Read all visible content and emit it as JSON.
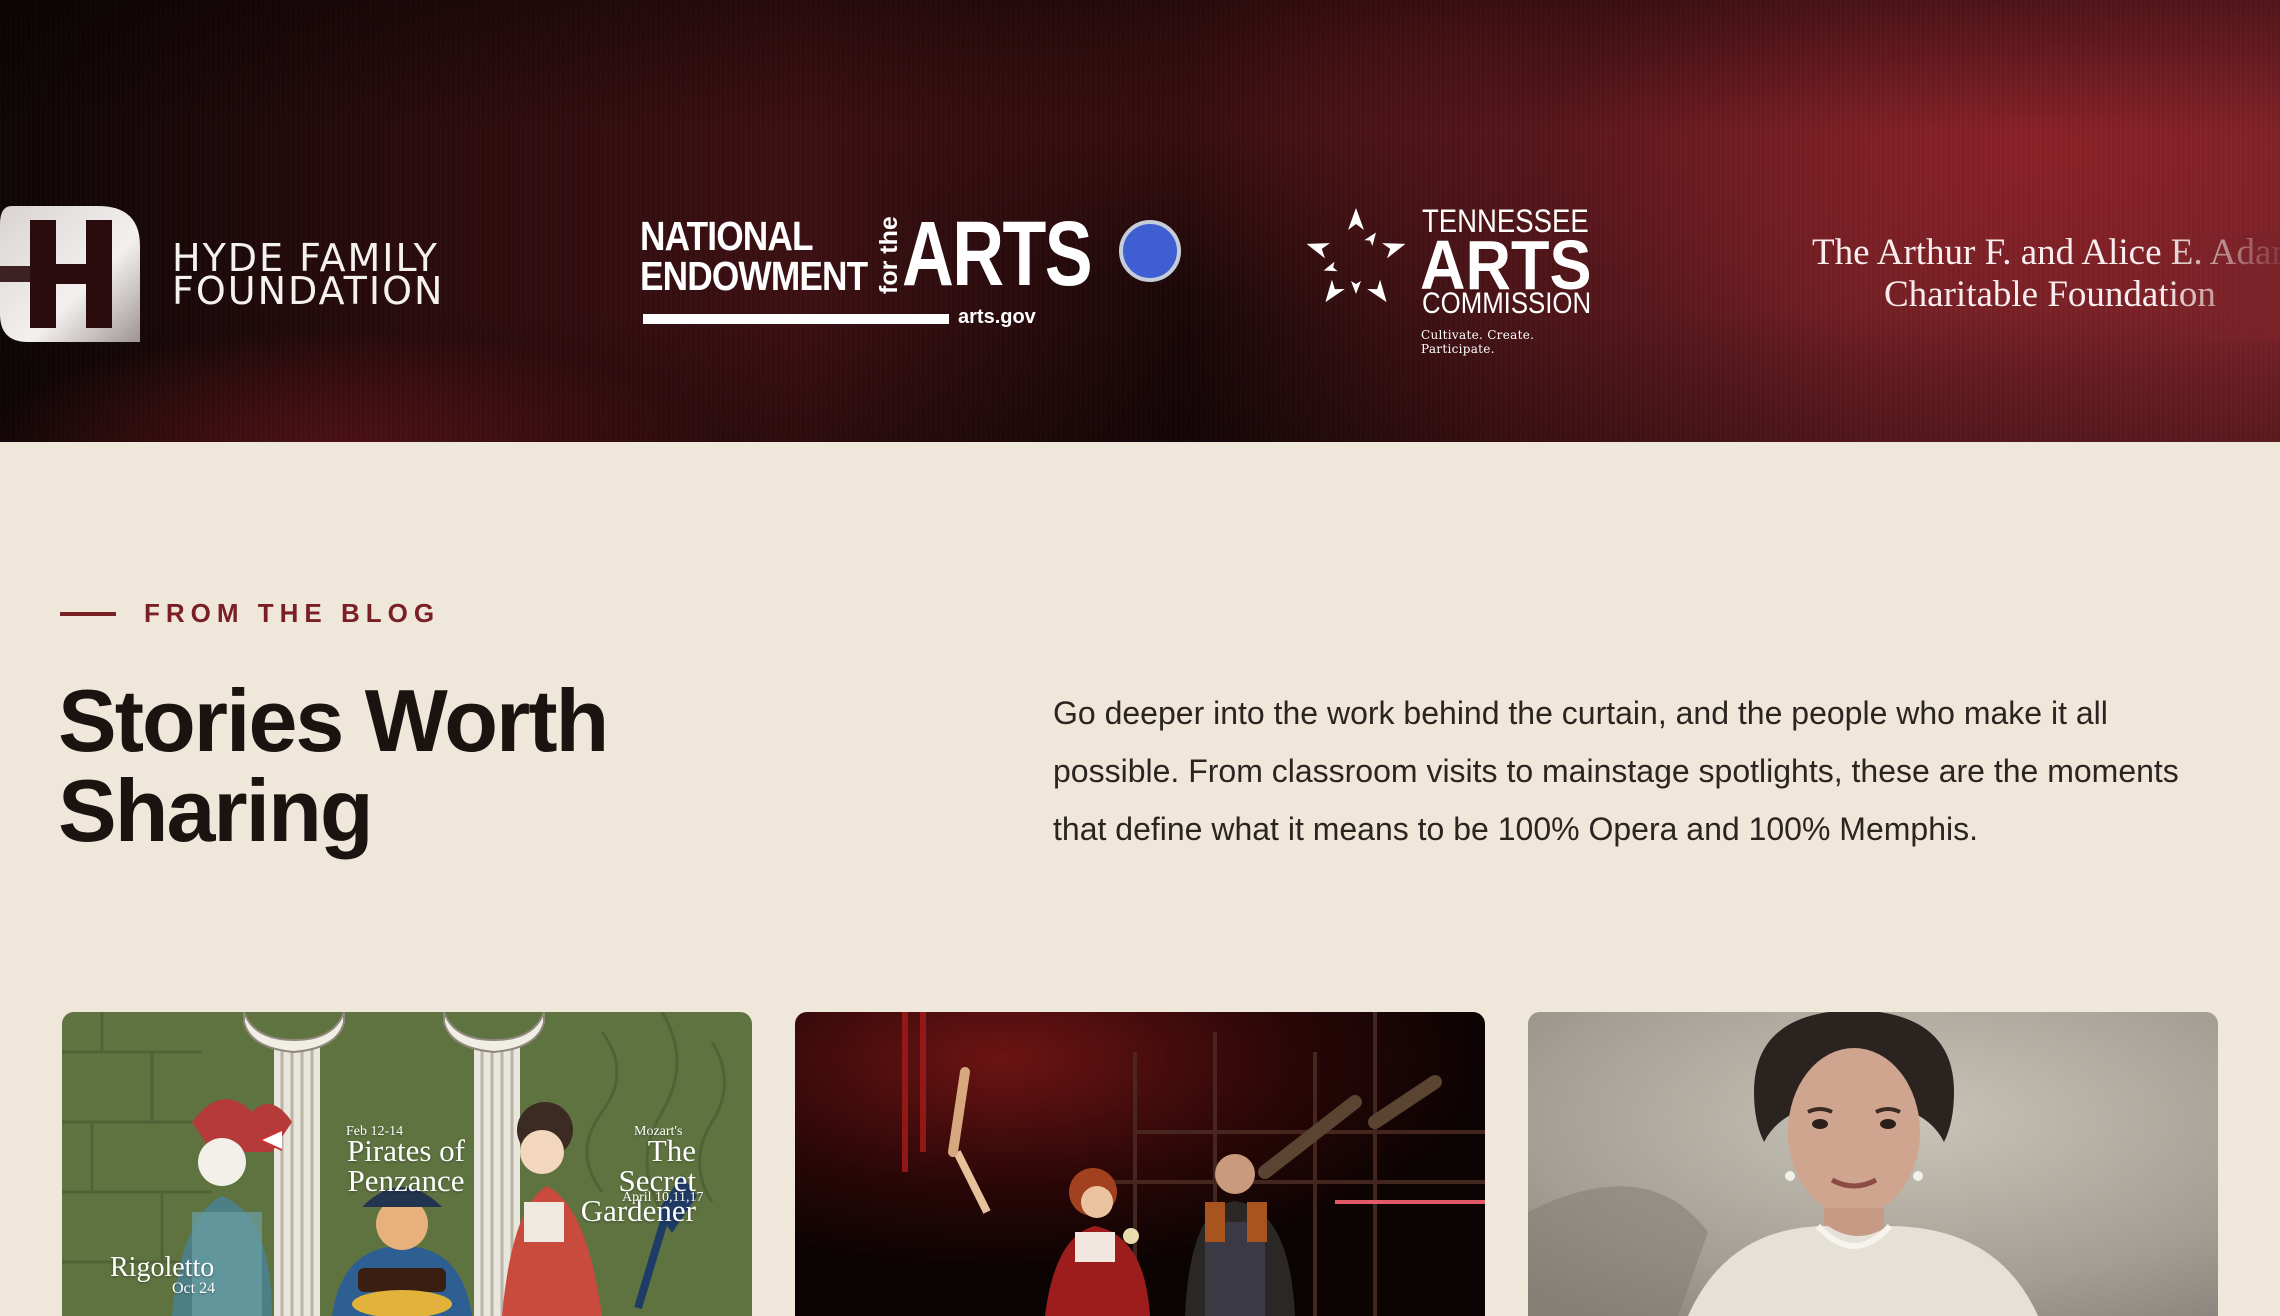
{
  "sponsors": {
    "hyde": {
      "name": "HYDE FAMILY\nFOUNDATION",
      "icon": "hyde-h-logo-icon"
    },
    "nea": {
      "left": "NATIONAL\nENDOWMENT",
      "for_the": "for the",
      "arts": "ARTS",
      "url": "arts.gov"
    },
    "tac": {
      "line1": "TENNESSEE",
      "line2": "ARTS",
      "line3": "COMMISSION",
      "tagline": "Cultivate. Create. Participate.",
      "icon": "tac-starburst-icon"
    },
    "adams": {
      "line1": "The Arthur F. and Alice E. Adams",
      "line2": "Charitable Foundation"
    }
  },
  "blog": {
    "eyebrow": "FROM THE BLOG",
    "heading": "Stories Worth Sharing",
    "intro": "Go deeper into the work behind the curtain, and the people who make it all possible. From classroom visits to mainstage spotlights, these are the moments that define what it means to be 100% Opera and 100% Memphis."
  },
  "cards": [
    {
      "poster": {
        "pirates_date": "Feb 12-14",
        "pirates_title": "Pirates of Penzance",
        "mozart": "Mozart's",
        "gardener_title": "The Secret Gardener",
        "gardener_date": "April 10,11,17",
        "rigoletto_title": "Rigoletto",
        "rigoletto_date": "Oct 24"
      }
    },
    {},
    {}
  ],
  "colors": {
    "page_bg": "#f0e7db",
    "accent": "#7a1f24",
    "heading": "#1a1411",
    "body_text": "#2c2420",
    "slider_dot": "#3f5ed1"
  }
}
